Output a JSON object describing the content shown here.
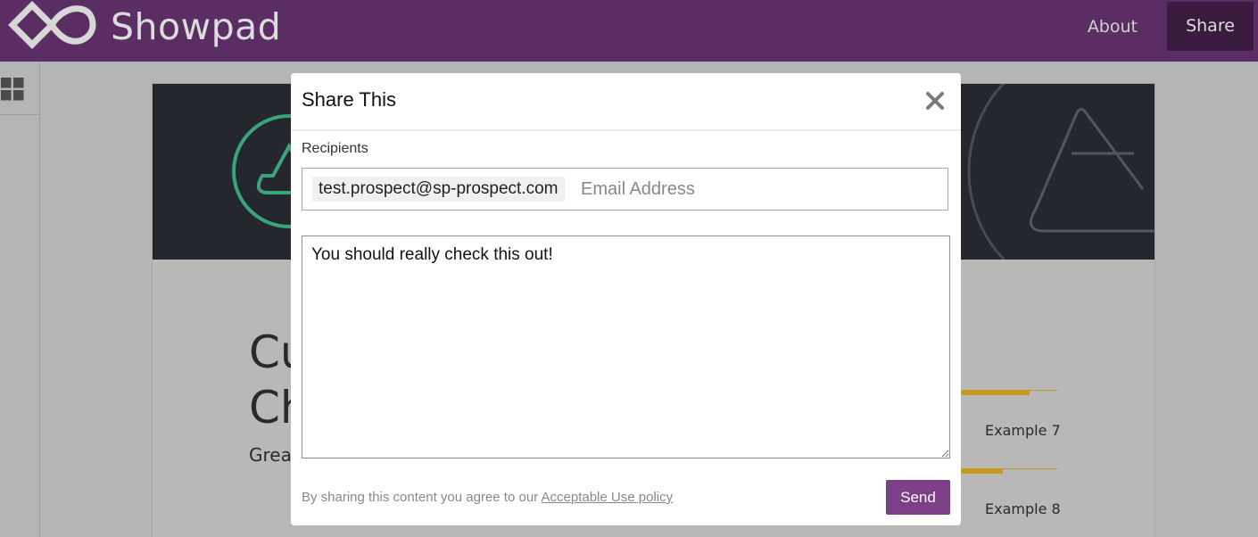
{
  "app": {
    "brand": "Showpad",
    "nav": {
      "about_label": "About",
      "share_label": "Share"
    },
    "colors": {
      "topbar": "#5b2e63",
      "share_active": "#3c1b40",
      "send_button": "#7d3f87",
      "accent_gold": "#c79a1a",
      "banner_green": "#3aa37a"
    }
  },
  "background_doc": {
    "heading": "Cu\nCh",
    "subheading": "Grea",
    "examples": [
      "Example 7",
      "Example 8"
    ]
  },
  "modal": {
    "title": "Share This",
    "close_icon": "close-icon",
    "recipients_label": "Recipients",
    "recipient_chip": "test.prospect@sp-prospect.com",
    "email_placeholder": "Email Address",
    "message": "You should really check this out!",
    "footer_prefix": "By sharing this content you agree to our ",
    "policy_link": "Acceptable Use policy",
    "send_label": "Send"
  }
}
